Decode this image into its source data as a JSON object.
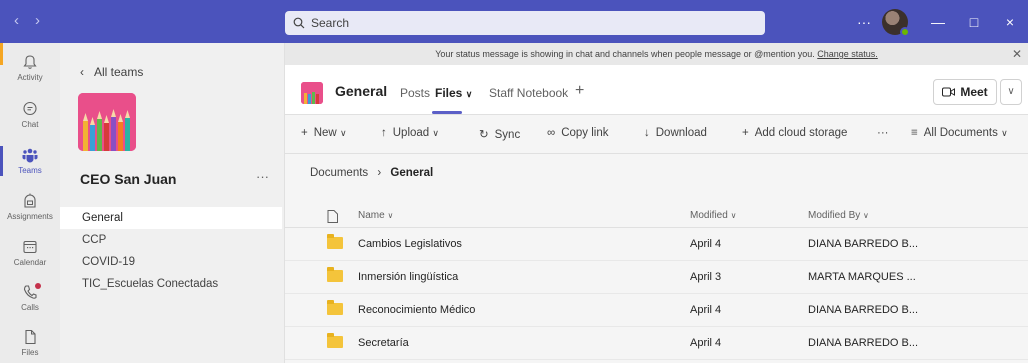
{
  "titlebar": {
    "search_placeholder": "Search",
    "more_label": "···",
    "minimize_label": "—",
    "maximize_label": "□",
    "close_label": "×"
  },
  "rail": {
    "items": [
      {
        "label": "Activity",
        "icon": "bell-icon"
      },
      {
        "label": "Chat",
        "icon": "chat-icon"
      },
      {
        "label": "Teams",
        "icon": "teams-icon",
        "active": true
      },
      {
        "label": "Assignments",
        "icon": "assignments-icon"
      },
      {
        "label": "Calendar",
        "icon": "calendar-icon"
      },
      {
        "label": "Calls",
        "icon": "phone-icon"
      },
      {
        "label": "Files",
        "icon": "file-icon"
      }
    ]
  },
  "sidebar": {
    "back_label": "All teams",
    "team_name": "CEO San Juan",
    "more_label": "···",
    "channels": [
      "General",
      "CCP",
      "COVID-19",
      "TIC_Escuelas Conectadas"
    ]
  },
  "banner": {
    "text": "Your status message is showing in chat and channels when people message or @mention you.",
    "link": "Change status."
  },
  "channel": {
    "title": "General",
    "tabs": [
      "Posts",
      "Files",
      "Staff Notebook"
    ],
    "active_tab": "Files",
    "add_tab": "+",
    "meet_label": "Meet"
  },
  "commands": {
    "new": "New",
    "upload": "Upload",
    "sync": "Sync",
    "copy_link": "Copy link",
    "download": "Download",
    "add_cloud": "Add cloud storage",
    "more": "···",
    "view": "All Documents"
  },
  "breadcrumb": {
    "root": "Documents",
    "current": "General"
  },
  "table": {
    "headers": {
      "name": "Name",
      "modified": "Modified",
      "modified_by": "Modified By"
    },
    "rows": [
      {
        "name": "Cambios Legislativos",
        "modified": "April 4",
        "modified_by": "DIANA BARREDO B..."
      },
      {
        "name": "Inmersión lingüística",
        "modified": "April 3",
        "modified_by": "MARTA MARQUES ..."
      },
      {
        "name": "Reconocimiento Médico",
        "modified": "April 4",
        "modified_by": "DIANA BARREDO B..."
      },
      {
        "name": "Secretaría",
        "modified": "April 4",
        "modified_by": "DIANA BARREDO B..."
      }
    ]
  },
  "colors": {
    "brand": "#4b53bc",
    "tab_accent": "#5b5fc7",
    "team_logo": "#e94f8a",
    "folder": "#f4c43b",
    "presence": "#6bb700"
  }
}
